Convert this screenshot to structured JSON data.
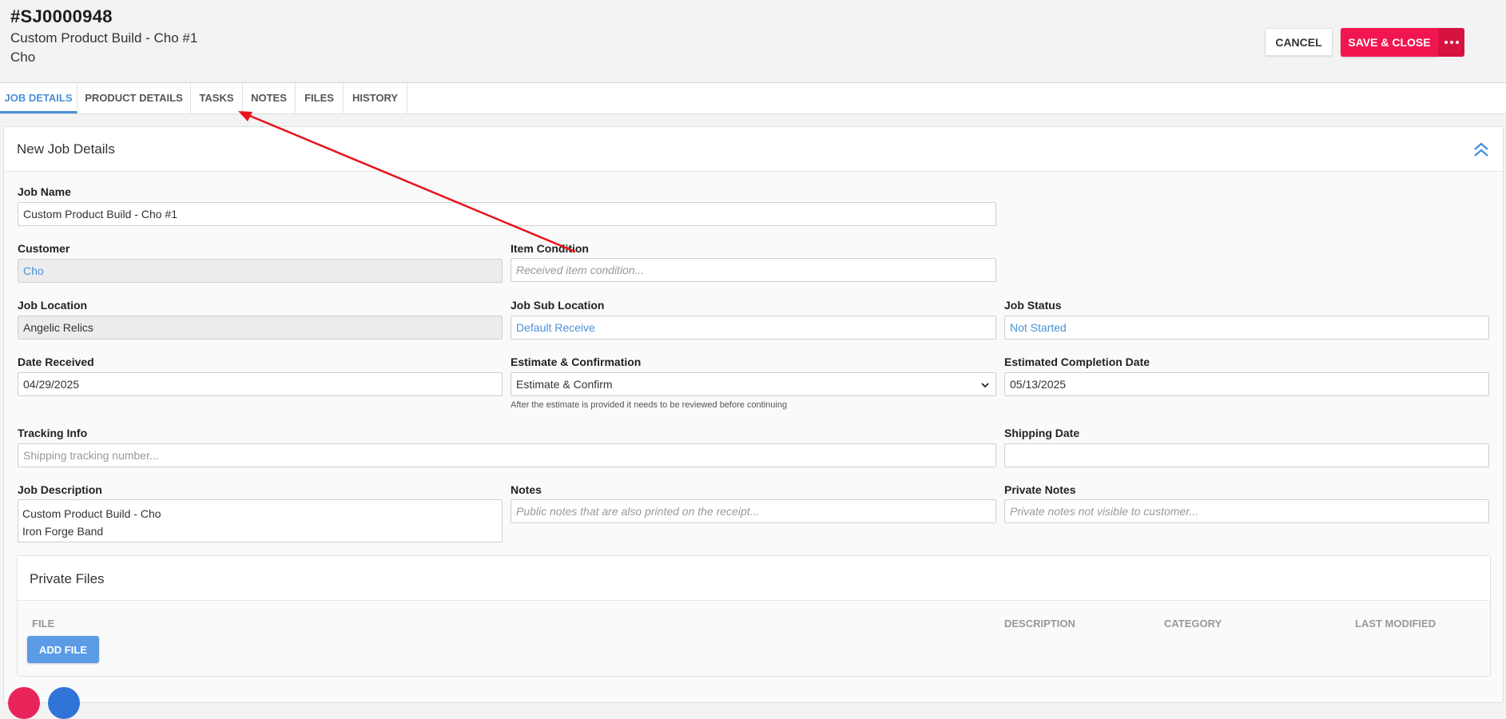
{
  "header": {
    "job_number": "#SJ0000948",
    "job_title": "Custom Product Build - Cho #1",
    "customer": "Cho",
    "cancel_label": "CANCEL",
    "save_label": "SAVE & CLOSE"
  },
  "tabs": [
    {
      "label": "JOB DETAILS",
      "active": true
    },
    {
      "label": "PRODUCT DETAILS",
      "active": false
    },
    {
      "label": "TASKS",
      "active": false
    },
    {
      "label": "NOTES",
      "active": false
    },
    {
      "label": "FILES",
      "active": false
    },
    {
      "label": "HISTORY",
      "active": false
    }
  ],
  "card": {
    "title": "New Job Details"
  },
  "form": {
    "job_name": {
      "label": "Job Name",
      "value": "Custom Product Build - Cho #1"
    },
    "customer": {
      "label": "Customer",
      "value": "Cho"
    },
    "item_condition": {
      "label": "Item Condition",
      "placeholder": "Received item condition..."
    },
    "job_location": {
      "label": "Job Location",
      "value": "Angelic Relics"
    },
    "job_sub_location": {
      "label": "Job Sub Location",
      "value": "Default Receive"
    },
    "job_status": {
      "label": "Job Status",
      "value": "Not Started"
    },
    "date_received": {
      "label": "Date Received",
      "value": "04/29/2025"
    },
    "estimate": {
      "label": "Estimate & Confirmation",
      "value": "Estimate & Confirm",
      "hint": "After the estimate is provided it needs to be reviewed before continuing"
    },
    "est_completion": {
      "label": "Estimated Completion Date",
      "value": "05/13/2025"
    },
    "tracking": {
      "label": "Tracking Info",
      "placeholder": "Shipping tracking number..."
    },
    "shipping_date": {
      "label": "Shipping Date",
      "value": ""
    },
    "job_description": {
      "label": "Job Description",
      "lines": [
        "Custom Product Build - Cho",
        "Iron Forge Band"
      ]
    },
    "notes": {
      "label": "Notes",
      "placeholder": "Public notes that are also printed on the receipt..."
    },
    "private_notes": {
      "label": "Private Notes",
      "placeholder": "Private notes not visible to customer..."
    }
  },
  "private_files": {
    "title": "Private Files",
    "columns": [
      "FILE",
      "DESCRIPTION",
      "CATEGORY",
      "LAST MODIFIED"
    ],
    "add_label": "ADD FILE"
  },
  "colors": {
    "accent": "#4a90d9",
    "save": "#f21650",
    "arrow": "#e8141c"
  },
  "icons": [
    "chevron-double-up-icon",
    "chevron-down-icon",
    "more-dots-icon"
  ]
}
